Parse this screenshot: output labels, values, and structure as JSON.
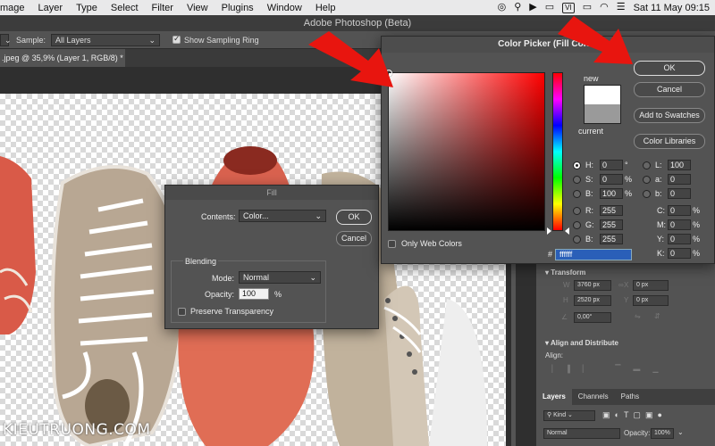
{
  "menubar": {
    "items": [
      "mage",
      "Layer",
      "Type",
      "Select",
      "Filter",
      "View",
      "Plugins",
      "Window",
      "Help"
    ],
    "status_box": "VI",
    "clock": "Sat 11 May  09:15"
  },
  "app": {
    "title": "Adobe Photoshop (Beta)",
    "options": {
      "sample_label": "Sample:",
      "sample_value": "All Layers",
      "sampling_ring_label": "Show Sampling Ring"
    },
    "doc_tab": ".jpeg @ 35,9% (Layer 1, RGB/8) *"
  },
  "watermark": "KIEUTRUONG.COM",
  "fill_dialog": {
    "title": "Fill",
    "contents_label": "Contents:",
    "contents_value": "Color...",
    "ok": "OK",
    "cancel": "Cancel",
    "blending_label": "Blending",
    "mode_label": "Mode:",
    "mode_value": "Normal",
    "opacity_label": "Opacity:",
    "opacity_value": "100",
    "opacity_unit": "%",
    "preserve_label": "Preserve Transparency"
  },
  "color_picker": {
    "title": "Color Picker (Fill Color)",
    "new_label": "new",
    "current_label": "current",
    "new_color": "#ffffff",
    "current_color": "#9a9a9a",
    "only_web_label": "Only Web Colors",
    "buttons": {
      "ok": "OK",
      "cancel": "Cancel",
      "add_swatches": "Add to Swatches",
      "color_libraries": "Color Libraries"
    },
    "hsb": [
      {
        "label": "H:",
        "value": "0",
        "unit": "°"
      },
      {
        "label": "S:",
        "value": "0",
        "unit": "%"
      },
      {
        "label": "B:",
        "value": "100",
        "unit": "%"
      }
    ],
    "rgb": [
      {
        "label": "R:",
        "value": "255"
      },
      {
        "label": "G:",
        "value": "255"
      },
      {
        "label": "B:",
        "value": "255"
      }
    ],
    "lab": [
      {
        "label": "L:",
        "value": "100"
      },
      {
        "label": "a:",
        "value": "0"
      },
      {
        "label": "b:",
        "value": "0"
      }
    ],
    "cmyk": [
      {
        "label": "C:",
        "value": "0",
        "unit": "%"
      },
      {
        "label": "M:",
        "value": "0",
        "unit": "%"
      },
      {
        "label": "Y:",
        "value": "0",
        "unit": "%"
      },
      {
        "label": "K:",
        "value": "0",
        "unit": "%"
      }
    ],
    "hex_label": "#",
    "hex_value": "ffffff"
  },
  "properties_panel": {
    "transform_label": "Transform",
    "w_label": "W",
    "w_value": "3760 px",
    "x_label": "X",
    "x_value": "0 px",
    "h_label": "H",
    "h_value": "2520 px",
    "y_label": "Y",
    "y_value": "0 px",
    "angle_value": "0,00°",
    "align_label": "Align and Distribute",
    "align_sub": "Align:"
  },
  "layers_panel": {
    "tabs": [
      "Layers",
      "Channels",
      "Paths"
    ],
    "kind_label": "Kind",
    "blend_value": "Normal",
    "opacity_label": "Opacity:",
    "opacity_value": "100%"
  }
}
